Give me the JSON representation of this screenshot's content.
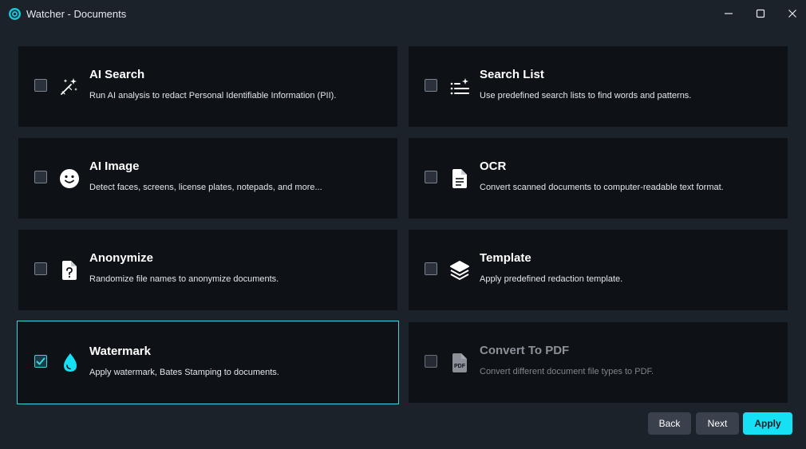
{
  "window": {
    "title": "Watcher - Documents",
    "controls": {
      "minimize": "minimize-icon",
      "maximize": "maximize-icon",
      "close": "close-icon"
    }
  },
  "options": [
    {
      "title": "AI Search",
      "description": "Run AI analysis to redact Personal Identifiable Information (PII).",
      "icon": "magic-wand-icon",
      "checked": false,
      "enabled": true
    },
    {
      "title": "Search List",
      "description": "Use predefined search lists to find words and patterns.",
      "icon": "list-sparkle-icon",
      "checked": false,
      "enabled": true
    },
    {
      "title": "AI Image",
      "description": "Detect faces, screens, license plates, notepads, and more...",
      "icon": "smiley-face-icon",
      "checked": false,
      "enabled": true
    },
    {
      "title": "OCR",
      "description": "Convert scanned documents to computer-readable text format.",
      "icon": "document-text-icon",
      "checked": false,
      "enabled": true
    },
    {
      "title": "Anonymize",
      "description": "Randomize file names to anonymize documents.",
      "icon": "document-question-icon",
      "checked": false,
      "enabled": true
    },
    {
      "title": "Template",
      "description": "Apply predefined redaction template.",
      "icon": "layers-icon",
      "checked": false,
      "enabled": true
    },
    {
      "title": "Watermark",
      "description": "Apply watermark, Bates Stamping to documents.",
      "icon": "water-drop-icon",
      "checked": true,
      "enabled": true
    },
    {
      "title": "Convert To PDF",
      "description": "Convert different document file types to PDF.",
      "icon": "pdf-file-icon",
      "checked": false,
      "enabled": false
    }
  ],
  "footer": {
    "back_label": "Back",
    "next_label": "Next",
    "apply_label": "Apply"
  },
  "colors": {
    "accent": "#16e0f3",
    "card_bg": "#0e1217",
    "window_bg": "#1c222a",
    "selected_border": "#3dd4e2"
  }
}
